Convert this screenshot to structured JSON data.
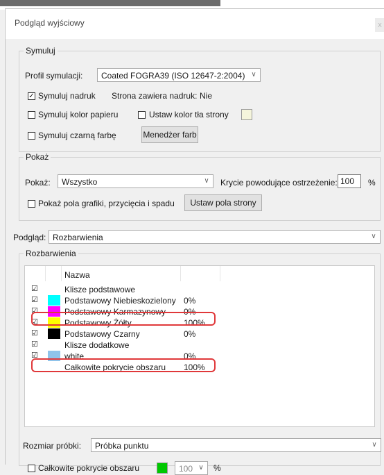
{
  "window": {
    "title": "Podgląd wyjściowy",
    "close_label": "x"
  },
  "simulate": {
    "legend": "Symuluj",
    "profile_label": "Profil symulacji:",
    "profile_value": "Coated FOGRA39 (ISO 12647-2:2004)",
    "simulate_overprint_label": "Symuluj nadruk",
    "simulate_overprint_checked": true,
    "page_contains_overprint": "Strona zawiera nadruk:",
    "page_contains_overprint_value": "Nie",
    "paper_color_label": "Symuluj kolor papieru",
    "page_bg_color_label": "Ustaw kolor tła strony",
    "black_ink_label": "Symuluj czarną farbę",
    "ink_manager_button": "Menedżer farb"
  },
  "show": {
    "legend": "Pokaż",
    "show_label": "Pokaż:",
    "show_value": "Wszystko",
    "coverage_warning_label": "Krycie powodujące ostrzeżenie:",
    "coverage_warning_value": "100",
    "coverage_unit": "%",
    "boxes_label": "Pokaż pola grafiki, przycięcia i spadu",
    "page_boxes_button": "Ustaw pola strony"
  },
  "preview": {
    "label": "Podgląd:",
    "value": "Rozbarwienia"
  },
  "separations": {
    "legend": "Rozbarwienia",
    "column_name": "Nazwa",
    "rows": [
      {
        "checked": true,
        "color": "",
        "name": "Klisze podstawowe",
        "pct": ""
      },
      {
        "checked": true,
        "color": "#00ffff",
        "name": "Podstawowy Niebieskozielony",
        "pct": "0%"
      },
      {
        "checked": true,
        "color": "#ff00ff",
        "name": "Podstawowy Karmazynowy",
        "pct": "0%"
      },
      {
        "checked": true,
        "color": "#ffff00",
        "name": "Podstawowy Żółty",
        "pct": "100%"
      },
      {
        "checked": true,
        "color": "#000000",
        "name": "Podstawowy Czarny",
        "pct": "0%"
      },
      {
        "checked": true,
        "color": "",
        "name": "Klisze dodatkowe",
        "pct": ""
      },
      {
        "checked": true,
        "color": "#8fc3ea",
        "name": "white",
        "pct": "0%"
      },
      {
        "checked": false,
        "color": "",
        "name": "Całkowite pokrycie obszaru",
        "pct": "100%"
      }
    ],
    "sample_size_label": "Rozmiar próbki:",
    "sample_size_value": "Próbka punktu",
    "total_coverage_label": "Całkowite pokrycie obszaru",
    "total_coverage_color": "#00c800",
    "total_coverage_value": "100",
    "total_coverage_unit": "%"
  },
  "colors": {
    "highlight": "#e0383a"
  }
}
